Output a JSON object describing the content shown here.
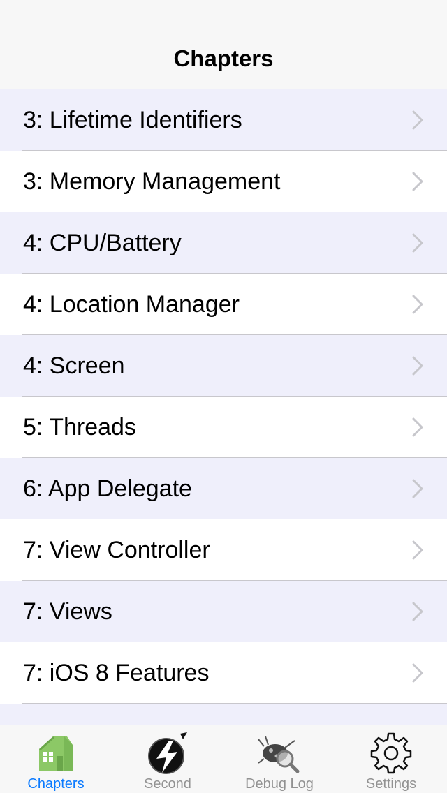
{
  "navbar": {
    "title": "Chapters"
  },
  "chapters": [
    {
      "label": "3: Lifetime Identifiers"
    },
    {
      "label": "3: Memory Management"
    },
    {
      "label": "4: CPU/Battery"
    },
    {
      "label": "4: Location Manager"
    },
    {
      "label": "4: Screen"
    },
    {
      "label": "5: Threads"
    },
    {
      "label": "6: App Delegate"
    },
    {
      "label": "7: View Controller"
    },
    {
      "label": "7: Views"
    },
    {
      "label": "7: iOS 8 Features"
    }
  ],
  "tabbar": {
    "selected": "Chapters",
    "tabs": [
      {
        "label": "Chapters",
        "icon": "house-icon"
      },
      {
        "label": "Second",
        "icon": "lightning-icon"
      },
      {
        "label": "Debug Log",
        "icon": "bug-magnifier-icon"
      },
      {
        "label": "Settings",
        "icon": "gear-icon"
      }
    ]
  },
  "colors": {
    "accent": "#0a7aff",
    "row_alt": "#efeffb",
    "tab_inactive": "#929292"
  }
}
